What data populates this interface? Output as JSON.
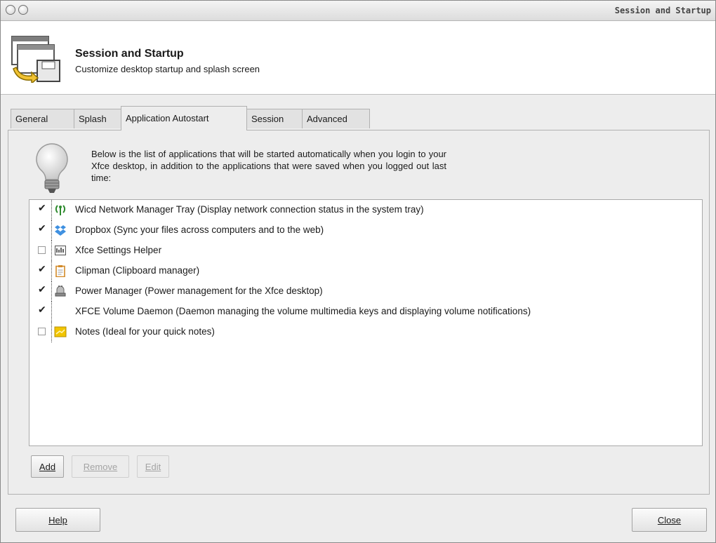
{
  "window": {
    "title": "Session and Startup"
  },
  "header": {
    "title": "Session and Startup",
    "subtitle": "Customize desktop startup and splash screen"
  },
  "tabs": [
    {
      "label": "General",
      "active": false
    },
    {
      "label": "Splash",
      "active": false
    },
    {
      "label": "Application Autostart",
      "active": true
    },
    {
      "label": "Session",
      "active": false
    },
    {
      "label": "Advanced",
      "active": false
    }
  ],
  "intro": "Below is the list of applications that will be started automatically when you login to your Xfce desktop, in addition to the applications that were saved when you logged out last time:",
  "apps": [
    {
      "label": "Wicd Network Manager Tray (Display network connection status in the system tray)",
      "checked": true,
      "icon": "wicd-antenna-icon"
    },
    {
      "label": "Dropbox (Sync your files across computers and to the web)",
      "checked": true,
      "icon": "dropbox-icon"
    },
    {
      "label": "Xfce Settings Helper",
      "checked": false,
      "icon": "settings-helper-icon"
    },
    {
      "label": "Clipman (Clipboard manager)",
      "checked": true,
      "icon": "clipboard-icon"
    },
    {
      "label": "Power Manager (Power management for the Xfce desktop)",
      "checked": true,
      "icon": "power-plug-icon"
    },
    {
      "label": "XFCE Volume Daemon (Daemon managing the volume multimedia keys and displaying volume notifications)",
      "checked": true,
      "icon": ""
    },
    {
      "label": "Notes (Ideal for your quick notes)",
      "checked": false,
      "icon": "notes-icon"
    }
  ],
  "buttons": {
    "add": "Add",
    "remove": "Remove",
    "edit": "Edit",
    "help": "Help",
    "close": "Close"
  },
  "colors": {
    "wicd_green": "#2e8b2e",
    "dropbox_blue": "#3d8fe0",
    "clipman_orange": "#d28a2a",
    "notes_yellow": "#f2c500"
  }
}
